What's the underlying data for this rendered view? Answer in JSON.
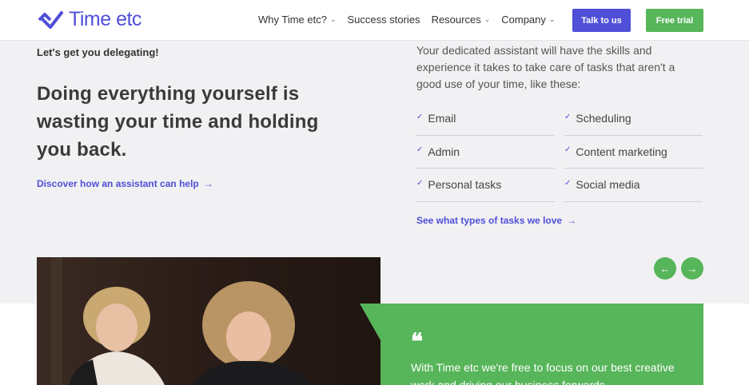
{
  "header": {
    "logo_text": "Time etc",
    "nav": [
      {
        "label": "Why Time etc?",
        "has_dropdown": true
      },
      {
        "label": "Success stories",
        "has_dropdown": false
      },
      {
        "label": "Resources",
        "has_dropdown": true
      },
      {
        "label": "Company",
        "has_dropdown": true
      }
    ],
    "cta_talk": "Talk to us",
    "cta_trial": "Free trial"
  },
  "left": {
    "eyebrow": "Let's get you delegating!",
    "headline": "Doing everything yourself is wasting your time and holding you back.",
    "discover_link": "Discover how an assistant can help",
    "arrow": "→"
  },
  "right": {
    "intro": "Your dedicated assistant will have the skills and experience it takes to take care of tasks that aren't a good use of your time, like these:",
    "tasks": [
      "Email",
      "Scheduling",
      "Admin",
      "Content marketing",
      "Personal tasks",
      "Social media"
    ],
    "see_link": "See what types of tasks we love",
    "arrow": "→"
  },
  "carousel": {
    "prev": "←",
    "next": "→"
  },
  "quote": {
    "mark": "❝",
    "text": "With Time etc we're free to focus on our best creative work and driving our business forwards"
  },
  "colors": {
    "brand": "#4f4fd8",
    "green": "#57b55a",
    "background": "#f1f1f3"
  }
}
